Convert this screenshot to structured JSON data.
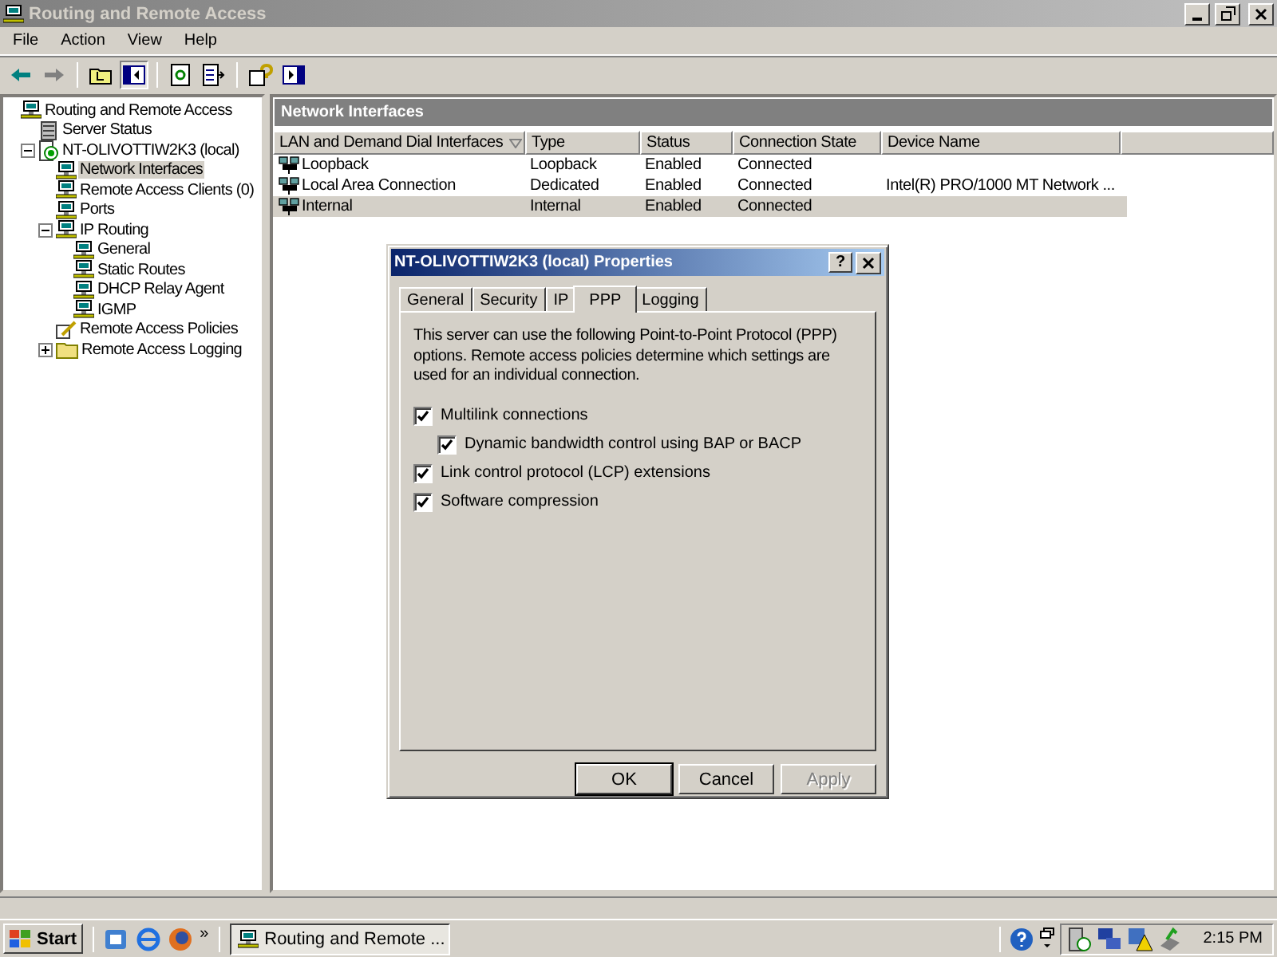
{
  "window": {
    "title": "Routing and Remote Access"
  },
  "menu": [
    "File",
    "Action",
    "View",
    "Help"
  ],
  "tree": [
    {
      "label": "Routing and Remote Access",
      "kind": "computer",
      "selected": false,
      "children": [
        {
          "label": "Server Status",
          "kind": "server",
          "selected": false
        },
        {
          "label": "NT-OLIVOTTIW2K3 (local)",
          "kind": "host",
          "selected": false,
          "expanded": true,
          "children": [
            {
              "label": "Network Interfaces",
              "kind": "computer",
              "selected": true
            },
            {
              "label": "Remote Access Clients (0)",
              "kind": "computer",
              "selected": false
            },
            {
              "label": "Ports",
              "kind": "computer",
              "selected": false
            },
            {
              "label": "IP Routing",
              "kind": "computer",
              "selected": false,
              "expanded": true,
              "children": [
                {
                  "label": "General",
                  "kind": "computer",
                  "selected": false
                },
                {
                  "label": "Static Routes",
                  "kind": "computer",
                  "selected": false
                },
                {
                  "label": "DHCP Relay Agent",
                  "kind": "computer",
                  "selected": false
                },
                {
                  "label": "IGMP",
                  "kind": "computer",
                  "selected": false
                }
              ]
            },
            {
              "label": "Remote Access Policies",
              "kind": "policy",
              "selected": false
            },
            {
              "label": "Remote Access Logging",
              "kind": "folder",
              "selected": false,
              "expanded": false
            }
          ]
        }
      ]
    }
  ],
  "pane": {
    "title": "Network Interfaces",
    "columns": [
      "LAN and Demand Dial Interfaces",
      "Type",
      "Status",
      "Connection State",
      "Device Name"
    ],
    "rows": [
      {
        "cells": [
          "Loopback",
          "Loopback",
          "Enabled",
          "Connected"
        ],
        "selected": false
      },
      {
        "cells": [
          "Local Area Connection",
          "Dedicated",
          "Enabled",
          "Connected",
          "Intel(R) PRO/1000 MT Network ..."
        ],
        "selected": false
      },
      {
        "cells": [
          "Internal",
          "Internal",
          "Enabled",
          "Connected"
        ],
        "selected": true
      }
    ]
  },
  "dialog": {
    "title": "NT-OLIVOTTIW2K3 (local) Properties",
    "help": "?",
    "tabs": [
      {
        "label": "General",
        "selected": false
      },
      {
        "label": "Security",
        "selected": false
      },
      {
        "label": "IP",
        "selected": false
      },
      {
        "label": "PPP",
        "selected": true
      },
      {
        "label": "Logging",
        "selected": false
      }
    ],
    "description": "This server can use the following Point-to-Point Protocol (PPP) options. Remote access policies determine which settings are used for an individual connection.",
    "options": [
      {
        "label": "Multilink connections",
        "checked": true,
        "children": [
          {
            "label": "Dynamic bandwidth control using BAP or BACP",
            "checked": true
          }
        ]
      },
      {
        "label": "Link control protocol (LCP) extensions",
        "checked": true
      },
      {
        "label": "Software compression",
        "checked": true
      }
    ],
    "buttons": [
      {
        "label": "OK",
        "disabled": false
      },
      {
        "label": "Cancel",
        "disabled": false
      },
      {
        "label": "Apply",
        "disabled": true
      }
    ]
  },
  "taskbar": {
    "start": "Start",
    "more": "»",
    "task": "Routing and Remote ...",
    "clock": "2:15 PM"
  }
}
